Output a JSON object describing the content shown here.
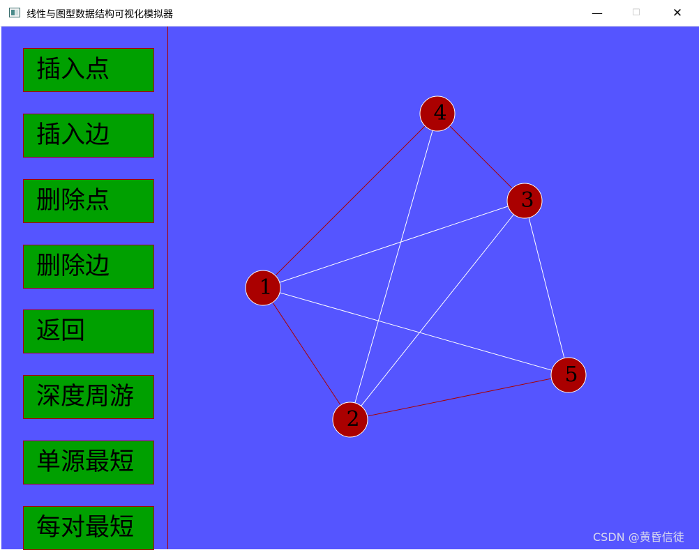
{
  "window": {
    "title": "线性与图型数据结构可视化模拟器",
    "controls": {
      "minimize": "—",
      "maximize": "☐",
      "close": "✕"
    }
  },
  "sidebar": {
    "buttons": [
      {
        "label": "插入点"
      },
      {
        "label": "插入边"
      },
      {
        "label": "删除点"
      },
      {
        "label": "删除边"
      },
      {
        "label": "返回"
      },
      {
        "label": "深度周游"
      },
      {
        "label": "单源最短"
      },
      {
        "label": "每对最短"
      }
    ]
  },
  "graph": {
    "vertices": [
      {
        "id": "1",
        "label": "1"
      },
      {
        "id": "2",
        "label": "2"
      },
      {
        "id": "3",
        "label": "3"
      },
      {
        "id": "4",
        "label": "4"
      },
      {
        "id": "5",
        "label": "5"
      }
    ],
    "edges": [
      {
        "from": "1",
        "to": "4",
        "style": "red"
      },
      {
        "from": "1",
        "to": "2",
        "style": "red"
      },
      {
        "from": "4",
        "to": "3",
        "style": "red"
      },
      {
        "from": "2",
        "to": "5",
        "style": "red"
      },
      {
        "from": "1",
        "to": "3",
        "style": "white"
      },
      {
        "from": "1",
        "to": "5",
        "style": "white"
      },
      {
        "from": "4",
        "to": "2",
        "style": "white"
      },
      {
        "from": "3",
        "to": "2",
        "style": "white"
      },
      {
        "from": "3",
        "to": "5",
        "style": "white"
      }
    ],
    "colors": {
      "canvas": "#5555ff",
      "node_fill": "#aa0000",
      "node_stroke": "#ffffff",
      "edge_red": "#aa0000",
      "edge_white": "#ffffff",
      "button_fill": "#00a000"
    }
  },
  "watermark": "CSDN @黄昏信徒"
}
